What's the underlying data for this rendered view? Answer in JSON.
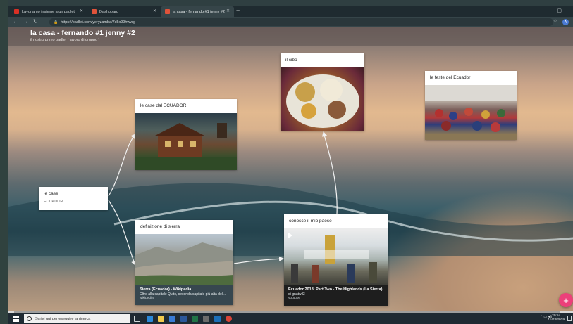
{
  "browser": {
    "tabs": [
      {
        "label": "Lavoriamo insieme a un padlet",
        "favicon_color": "#d93025",
        "icon": "gmail-icon",
        "active": false
      },
      {
        "label": "Dashboard",
        "favicon_color": "#e0533a",
        "icon": "padlet-icon",
        "active": false
      },
      {
        "label": "la casa - fernando #1 jenny #2",
        "favicon_color": "#e0533a",
        "icon": "padlet-icon",
        "active": true
      }
    ],
    "new_tab": "+",
    "window_controls": "– ▢",
    "url": "https://padlet.com/yeryzamba/7s5x99hwvrg",
    "profile_initial": "A"
  },
  "board": {
    "title": "la casa - fernando #1 jenny #2",
    "subtitle": "il nostro primo padlet [ lavoro di gruppo ]",
    "accent_color": "#ec407a"
  },
  "cards": {
    "le_case": {
      "title": "le case",
      "subtitle": "ECUADOR"
    },
    "case_ecuador": {
      "title": "le case dal ECUADOR"
    },
    "cibo": {
      "title": "il cibo"
    },
    "feste": {
      "title": "le feste del Ecuador"
    },
    "sierra": {
      "title": "definizione di sierra",
      "link_title": "Sierra (Ecuador) - Wikipedia",
      "link_desc": "Oltre alla capitale Quito, seconda capitale più alta del ...",
      "link_source": "wikipedia"
    },
    "paese": {
      "title": "conosce il mio paese",
      "link_title": "Ecuador 2018: Part Two - The Highlands (La Sierra)",
      "link_author": "di gnatwil3",
      "link_source": "youtube"
    }
  },
  "fab_label": "+",
  "taskbar": {
    "search_placeholder": "Scrivi qui per eseguire la ricerca",
    "time": "20:54",
    "date": "11/03/2019"
  }
}
